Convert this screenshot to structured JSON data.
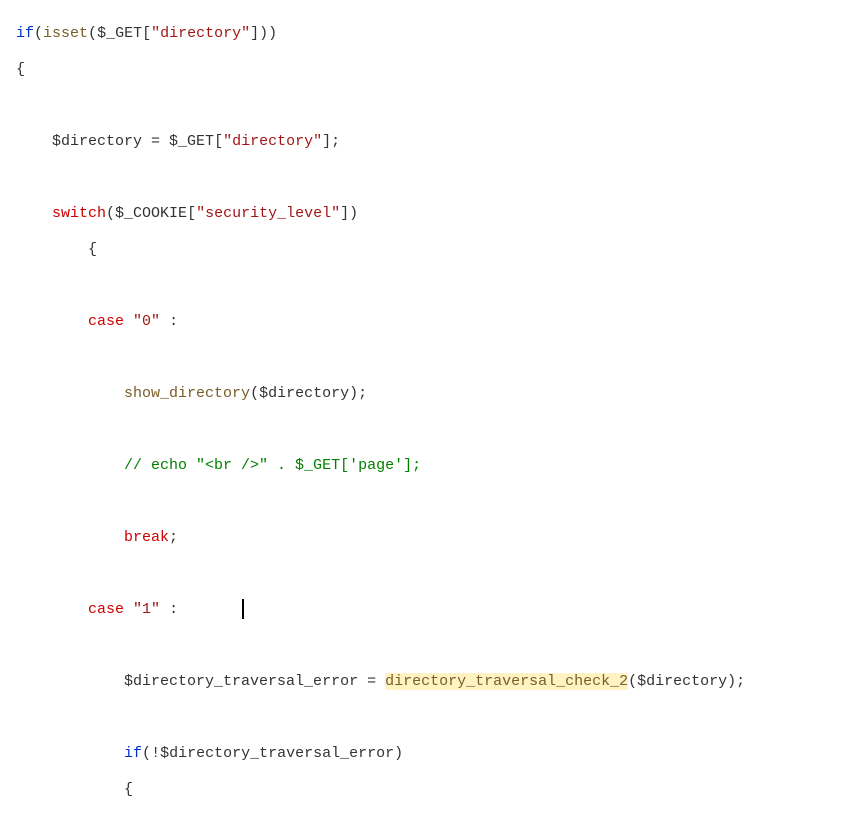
{
  "code": {
    "line1_if": "if",
    "line1_isset": "isset",
    "line1_var": "$_GET",
    "line1_str": "\"directory\"",
    "line2_brace": "{",
    "line3_var1": "$directory",
    "line3_eq": " = ",
    "line3_var2": "$_GET",
    "line3_str": "\"directory\"",
    "line4_switch": "switch",
    "line4_var": "$_COOKIE",
    "line4_str": "\"security_level\"",
    "line5_brace": "{",
    "line6_case": "case",
    "line6_str": "\"0\"",
    "line6_colon": " :",
    "line7_fn": "show_directory",
    "line7_var": "$directory",
    "line8_comment": "// echo \"<br />\" . $_GET['page'];",
    "line9_break": "break",
    "line10_case": "case",
    "line10_str": "\"1\"",
    "line10_colon": " :",
    "line11_var1": "$directory_traversal_error",
    "line11_eq": " = ",
    "line11_fn": "directory_traversal_check_2",
    "line11_var2": "$directory",
    "line12_if": "if",
    "line12_not": "!",
    "line12_var": "$directory_traversal_error",
    "line13_brace": "{"
  }
}
